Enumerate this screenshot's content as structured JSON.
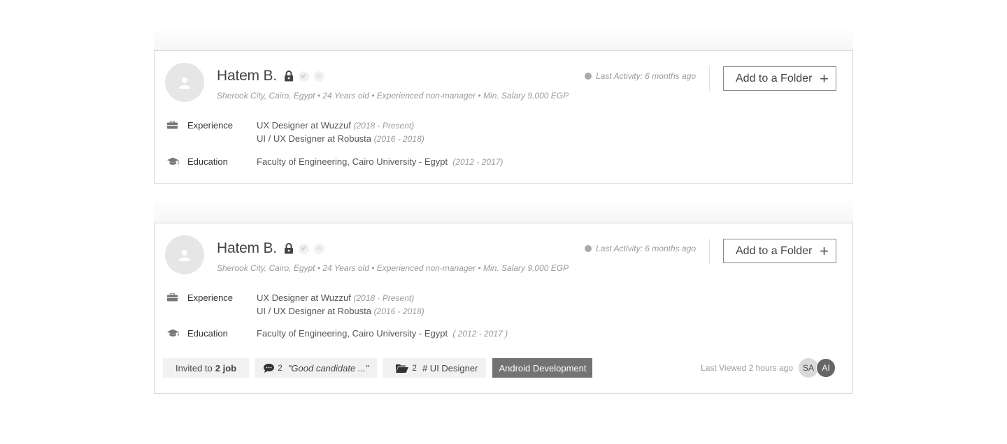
{
  "cards": [
    {
      "name": "Hatem B.",
      "social": [
        "twitter",
        "in"
      ],
      "meta": "Sherook City, Cairo, Egypt • 24 Years old • Experienced non-manager •  Min. Salary 9,000 EGP",
      "last_activity": "Last Activity: 6 months ago",
      "add_folder_label": "Add to a Folder",
      "experience_label": "Experience",
      "experience": [
        {
          "text": "UX Designer at Wuzzuf",
          "date": "(2018 - Present)"
        },
        {
          "text": "UI / UX Designer at Robusta",
          "date": "(2016 - 2018)"
        }
      ],
      "education_label": "Education",
      "education": {
        "text": "Faculty of Engineering, Cairo University - Egypt",
        "date": "(2012 - 2017)"
      }
    },
    {
      "name": "Hatem B.",
      "social": [
        "twitter",
        "in"
      ],
      "meta": "Sherook City, Cairo, Egypt • 24 Years old • Experienced non-manager •  Min. Salary 9,000 EGP",
      "last_activity": "Last Activity: 6 months ago",
      "add_folder_label": "Add to a Folder",
      "experience_label": "Experience",
      "experience": [
        {
          "text": "UX Designer at Wuzzuf",
          "date": "(2018 - Present)"
        },
        {
          "text": "UI / UX Designer at Robusta",
          "date": "(2016 - 2018)"
        }
      ],
      "education_label": "Education",
      "education": {
        "text": "Faculty of Engineering, Cairo University - Egypt",
        "date": "( 2012 - 2017 )"
      },
      "tags": {
        "invited_prefix": "Invited to",
        "invited_count": "2 job",
        "comments_count": "2",
        "comment_text": "\"Good candidate ...\"",
        "folders_count": "2",
        "folder_name": "# UI Designer",
        "skill": "Android Development"
      },
      "last_viewed": "Last Viewed 2 hours ago",
      "viewers": [
        "SA",
        "AI"
      ]
    }
  ]
}
